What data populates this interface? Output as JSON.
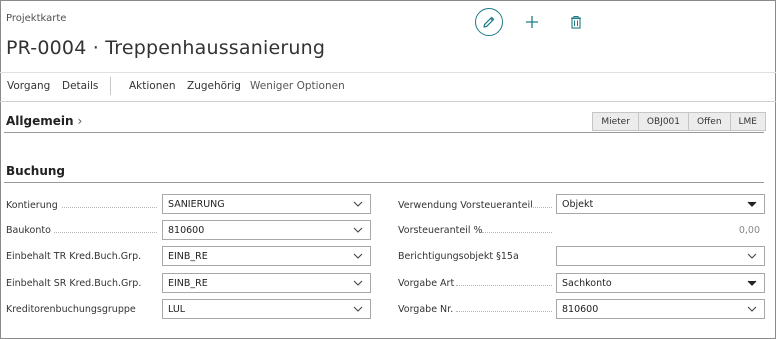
{
  "header": {
    "caption": "Projektkarte",
    "title": "PR-0004 · Treppenhaussanierung"
  },
  "toolbar": {
    "edit_icon": "pencil-icon",
    "new_icon": "plus-icon",
    "delete_icon": "trash-icon"
  },
  "menu": {
    "items": [
      {
        "label": "Vorgang"
      },
      {
        "label": "Details"
      },
      {
        "label": "Aktionen"
      },
      {
        "label": "Zugehörig"
      },
      {
        "label": "Weniger Optionen"
      }
    ]
  },
  "section": {
    "title": "Allgemein",
    "chips": [
      "Mieter",
      "OBJ001",
      "Offen",
      "LME"
    ]
  },
  "group": {
    "title": "Buchung",
    "left_fields": [
      {
        "label": "Kontierung",
        "value": "SANIERUNG"
      },
      {
        "label": "Baukonto",
        "value": "810600"
      },
      {
        "label": "Einbehalt TR Kred.Buch.Grp.",
        "value": "EINB_RE"
      },
      {
        "label": "Einbehalt SR Kred.Buch.Grp.",
        "value": "EINB_RE"
      },
      {
        "label": "Kreditorenbuchungsgruppe",
        "value": "LUL"
      }
    ],
    "right_fields": [
      {
        "label": "Verwendung Vorsteueranteil",
        "value": "Objekt"
      },
      {
        "label": "Vorsteueranteil %",
        "value": "0,00"
      },
      {
        "label": "Berichtigungsobjekt §15a",
        "value": ""
      },
      {
        "label": "Vorgabe Art",
        "value": "Sachkonto"
      },
      {
        "label": "Vorgabe Nr.",
        "value": "810600"
      }
    ]
  },
  "colors": {
    "accent": "#1e7c86",
    "chip_bg": "#ececec"
  }
}
